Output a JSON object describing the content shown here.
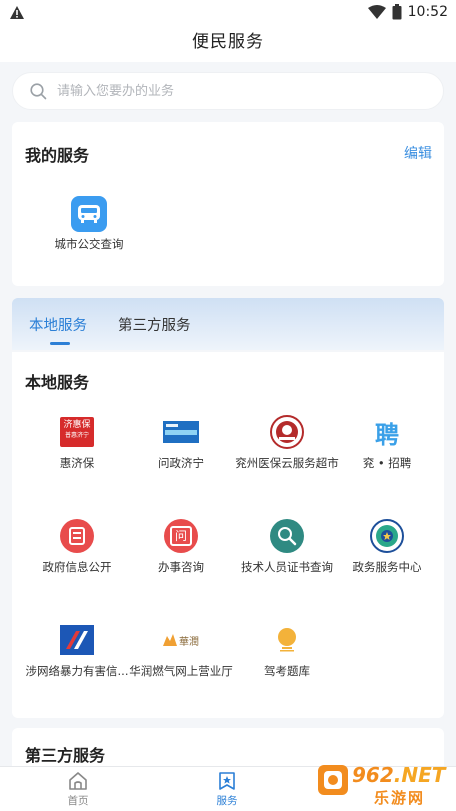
{
  "status_bar": {
    "time": "10:52"
  },
  "header": {
    "title": "便民服务"
  },
  "search": {
    "placeholder": "请输入您要办的业务"
  },
  "my_services": {
    "title": "我的服务",
    "edit_label": "编辑",
    "items": [
      {
        "label": "城市公交查询",
        "icon": "bus-icon"
      }
    ]
  },
  "tabs": [
    {
      "label": "本地服务",
      "active": true
    },
    {
      "label": "第三方服务",
      "active": false
    }
  ],
  "local_services": {
    "title": "本地服务",
    "items": [
      {
        "label": "惠济保",
        "icon": "huijibao-logo",
        "logo_line1": "济惠保",
        "logo_line2": "普惠济宁"
      },
      {
        "label": "问政济宁",
        "icon": "wenzheng-logo"
      },
      {
        "label": "兖州医保云服务超市",
        "icon": "yibao-logo"
      },
      {
        "label": "兖 • 招聘",
        "icon": "recruit-logo",
        "logo_text": "聘"
      },
      {
        "label": "政府信息公开",
        "icon": "gov-info-icon"
      },
      {
        "label": "办事咨询",
        "icon": "consult-icon",
        "logo_text": "问"
      },
      {
        "label": "技术人员证书查询",
        "icon": "certificate-search-icon"
      },
      {
        "label": "政务服务中心",
        "icon": "gov-center-logo"
      },
      {
        "label": "涉网络暴力有害信...",
        "icon": "report-logo"
      },
      {
        "label": "华润燃气网上营业厅",
        "icon": "gas-logo",
        "logo_text": "華潤"
      },
      {
        "label": "驾考题库",
        "icon": "driving-test-logo"
      }
    ]
  },
  "third_party": {
    "title": "第三方服务"
  },
  "bottom_nav": [
    {
      "label": "首页",
      "icon": "home-icon",
      "active": false
    },
    {
      "label": "服务",
      "icon": "service-star-icon",
      "active": true
    }
  ],
  "watermark": {
    "brand": "962",
    "suffix": ".NET",
    "sub": "乐游网"
  },
  "colors": {
    "accent": "#2b7fd6",
    "icon_red": "#e84c4c",
    "bus_blue": "#3b9cf0"
  }
}
